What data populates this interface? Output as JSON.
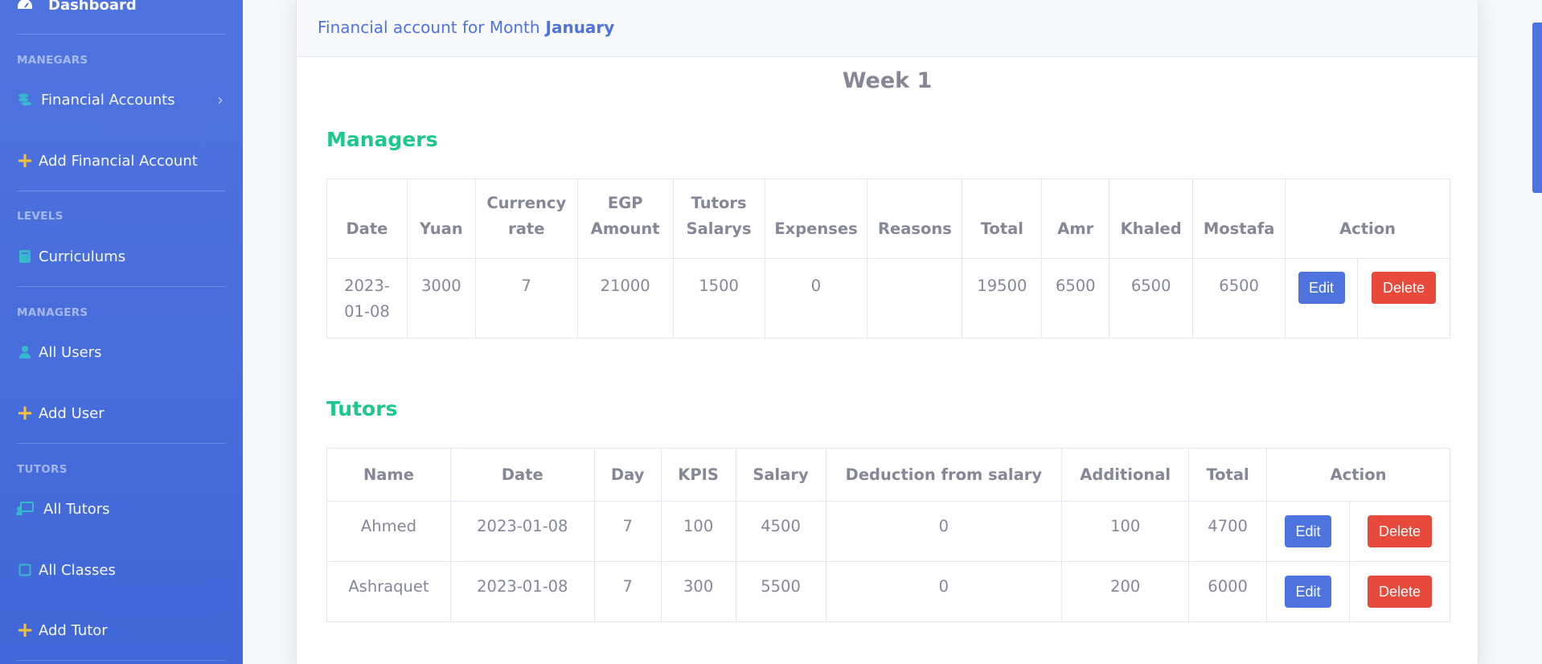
{
  "sidebar": {
    "dashboard": "Dashboard",
    "headings": {
      "manegars": "MANEGARS",
      "levels": "LEVELS",
      "managers": "MANAGERS",
      "tutors": "TUTORS"
    },
    "items": {
      "financial_accounts": "Financial Accounts",
      "add_financial_account": "Add Financial Account",
      "curriculums": "Curriculums",
      "all_users": "All Users",
      "add_user": "Add User",
      "all_tutors": "All Tutors",
      "all_classes": "All Classes",
      "add_tutor": "Add Tutor"
    },
    "icons": {
      "dashboard": "tachometer-icon",
      "financial": "coins-icon",
      "curriculums": "book-icon",
      "users": "user-icon",
      "tutors": "chalkboard-teacher-icon",
      "classes": "square-icon",
      "plus": "plus-icon",
      "chevron": "chevron-right-icon"
    }
  },
  "header": {
    "prefix": "Financial account for Month",
    "month": "January"
  },
  "week_title": "Week 1",
  "managers": {
    "title": "Managers",
    "columns": [
      "Date",
      "Yuan",
      "Currency rate",
      "EGP Amount",
      "Tutors Salarys",
      "Expenses",
      "Reasons",
      "Total",
      "Amr",
      "Khaled",
      "Mostafa",
      "Action"
    ],
    "rows": [
      {
        "date": "2023-01-08",
        "yuan": "3000",
        "rate": "7",
        "egp": "21000",
        "tutors_salarys": "1500",
        "expenses": "0",
        "reasons": "",
        "total": "19500",
        "amr": "6500",
        "khaled": "6500",
        "mostafa": "6500",
        "edit": "Edit",
        "delete": "Delete"
      }
    ]
  },
  "tutors": {
    "title": "Tutors",
    "columns": [
      "Name",
      "Date",
      "Day",
      "KPIS",
      "Salary",
      "Deduction from salary",
      "Additional",
      "Total",
      "Action"
    ],
    "rows": [
      {
        "name": "Ahmed",
        "date": "2023-01-08",
        "day": "7",
        "kpis": "100",
        "salary": "4500",
        "deduction": "0",
        "additional": "100",
        "total": "4700",
        "edit": "Edit",
        "delete": "Delete"
      },
      {
        "name": "Ashraquet",
        "date": "2023-01-08",
        "day": "7",
        "kpis": "300",
        "salary": "5500",
        "deduction": "0",
        "additional": "200",
        "total": "6000",
        "edit": "Edit",
        "delete": "Delete"
      }
    ]
  },
  "colors": {
    "primary": "#4e73df",
    "success": "#1cc88a",
    "danger": "#e74a3b",
    "warning": "#f6c23e",
    "text": "#858796"
  }
}
